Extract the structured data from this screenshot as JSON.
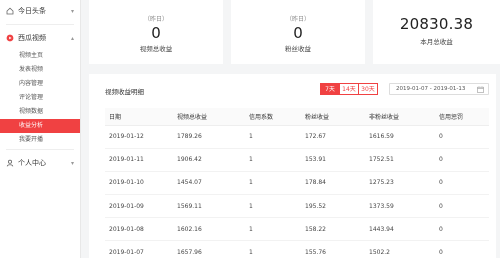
{
  "sidebar": {
    "sections": [
      {
        "label": "今日头条",
        "icon": "home-icon",
        "expanded": false
      },
      {
        "label": "西瓜视频",
        "icon": "video-icon",
        "expanded": true
      },
      {
        "label": "个人中心",
        "icon": "user-icon",
        "expanded": false
      }
    ],
    "video_items": [
      {
        "label": "视频主页",
        "active": false
      },
      {
        "label": "发表视频",
        "active": false
      },
      {
        "label": "内容管理",
        "active": false
      },
      {
        "label": "评论管理",
        "active": false
      },
      {
        "label": "视频数据",
        "active": false
      },
      {
        "label": "收益分析",
        "active": true
      },
      {
        "label": "我要开播",
        "active": false
      }
    ],
    "accent_color": "#f04142"
  },
  "stats": {
    "video_income": {
      "sub": "（昨日）",
      "value": "0",
      "label": "视频总收益"
    },
    "fans_income": {
      "sub": "（昨日）",
      "value": "0",
      "label": "粉丝收益"
    },
    "month_income": {
      "value": "20830.38",
      "label": "本月总收益"
    }
  },
  "panel": {
    "title": "视频收益明细",
    "range_tabs": [
      {
        "label": "7天",
        "active": true
      },
      {
        "label": "14天",
        "active": false
      },
      {
        "label": "30天",
        "active": false
      }
    ],
    "date_range": "2019-01-07 - 2019-01-13",
    "columns": [
      "日期",
      "视频总收益",
      "信用系数",
      "粉丝收益",
      "非粉丝收益",
      "信用惩罚"
    ],
    "rows": [
      [
        "2019-01-12",
        "1789.26",
        "1",
        "172.67",
        "1616.59",
        "0"
      ],
      [
        "2019-01-11",
        "1906.42",
        "1",
        "153.91",
        "1752.51",
        "0"
      ],
      [
        "2019-01-10",
        "1454.07",
        "1",
        "178.84",
        "1275.23",
        "0"
      ],
      [
        "2019-01-09",
        "1569.11",
        "1",
        "195.52",
        "1373.59",
        "0"
      ],
      [
        "2019-01-08",
        "1602.16",
        "1",
        "158.22",
        "1443.94",
        "0"
      ],
      [
        "2019-01-07",
        "1657.96",
        "1",
        "155.76",
        "1502.2",
        "0"
      ]
    ]
  }
}
